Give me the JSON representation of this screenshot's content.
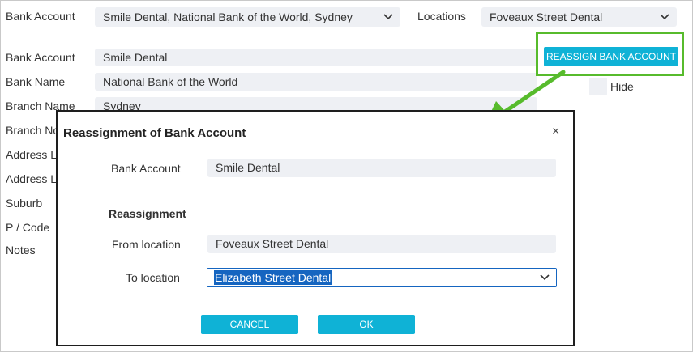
{
  "top_bar": {
    "bank_account_label": "Bank Account",
    "bank_account_value": "Smile Dental, National Bank of the World, Sydney",
    "locations_label": "Locations",
    "locations_value": "Foveaux Street Dental"
  },
  "form": {
    "bank_account_label": "Bank Account",
    "bank_account_value": "Smile Dental",
    "bank_name_label": "Bank Name",
    "bank_name_value": "National Bank of the World",
    "branch_name_label": "Branch Name",
    "branch_name_value": "Sydney",
    "branch_no_label": "Branch No",
    "address1_label": "Address Line 1",
    "address2_label": "Address Line 2",
    "suburb_label": "Suburb",
    "postcode_label": "P / Code",
    "notes_label": "Notes",
    "reassign_button": "REASSIGN BANK ACCOUNT",
    "hide_label": "Hide"
  },
  "dialog": {
    "title": "Reassignment of Bank Account",
    "close_glyph": "×",
    "bank_account_label": "Bank Account",
    "bank_account_value": "Smile Dental",
    "section_heading": "Reassignment",
    "from_label": "From location",
    "from_value": "Foveaux Street Dental",
    "to_label": "To location",
    "to_value": "Elizabeth Street Dental",
    "cancel_button": "CANCEL",
    "ok_button": "OK"
  },
  "colors": {
    "accent": "#0fb2d6",
    "field_bg": "#eef0f4",
    "highlight_green": "#57bb2c",
    "selection": "#1565c0"
  }
}
